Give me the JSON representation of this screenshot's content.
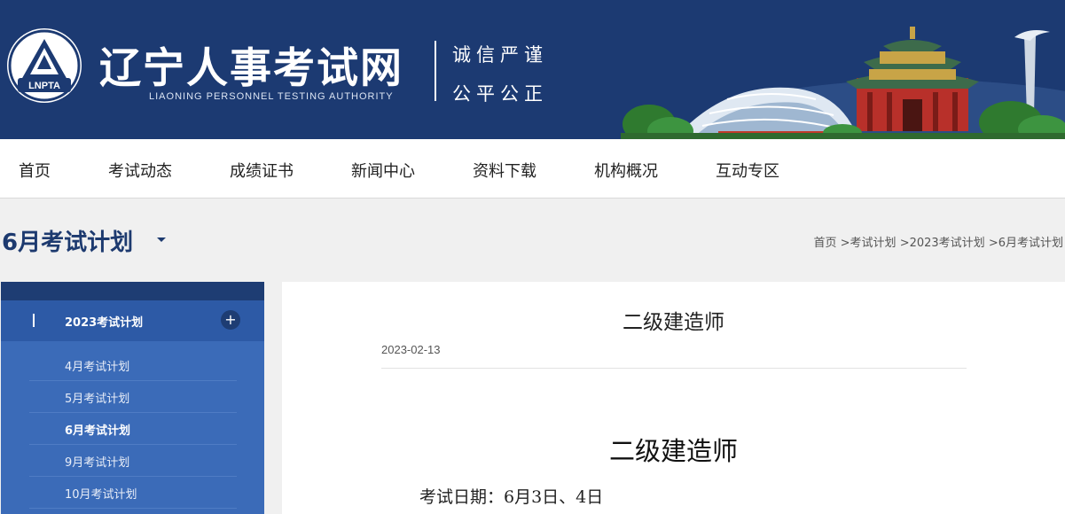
{
  "header": {
    "logo_badge": "LNPTA",
    "site_title": "辽宁人事考试网",
    "site_subtitle": "LIAONING PERSONNEL TESTING AUTHORITY",
    "slogan_line1": "诚信严谨",
    "slogan_line2": "公平公正"
  },
  "nav": {
    "items": [
      "首页",
      "考试动态",
      "成绩证书",
      "新闻中心",
      "资料下载",
      "机构概况",
      "互动专区"
    ]
  },
  "page": {
    "title": "6月考试计划"
  },
  "breadcrumb": {
    "items": [
      "首页",
      "考试计划",
      "2023考试计划",
      "6月考试计划"
    ],
    "separator": " >"
  },
  "sidebar": {
    "group_label": "2023考试计划",
    "expand_glyph": "+",
    "items": [
      "4月考试计划",
      "5月考试计划",
      "6月考试计划",
      "9月考试计划",
      "10月考试计划"
    ],
    "active_index": 2
  },
  "article": {
    "title": "二级建造师",
    "date": "2023-02-13",
    "heading": "二级建造师",
    "exam_date_line": "考试日期：6月3日、4日"
  },
  "colors": {
    "header_bg": "#1c3a72",
    "title_blue": "#1d3a6f",
    "sidebar_blue": "#3b6bb8",
    "sidebar_dark": "#1e3d73"
  }
}
